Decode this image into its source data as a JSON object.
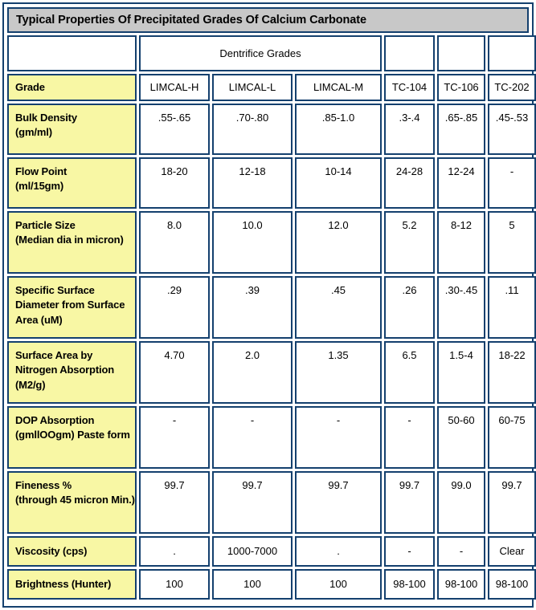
{
  "table": {
    "title": "Typical Properties Of Precipitated Grades Of Calcium Carbonate",
    "group_header": {
      "label_blank": "",
      "dentrifice_grades": "Dentrifice Grades",
      "tc104_blank": "",
      "tc106_blank": "",
      "tc202_blank": ""
    },
    "columns": {
      "property": "Grade",
      "grades": [
        "LIMCAL-H",
        "LIMCAL-L",
        "LIMCAL-M",
        "TC-104",
        "TC-106",
        "TC-202"
      ]
    },
    "rows": [
      {
        "property": "Bulk Density",
        "unit": "(gm/ml)",
        "values": [
          ".55-.65",
          ".70-.80",
          ".85-1.0",
          ".3-.4",
          ".65-.85",
          ".45-.53"
        ]
      },
      {
        "property": "Flow Point",
        "unit": "(ml/15gm)",
        "values": [
          "18-20",
          "12-18",
          "10-14",
          "24-28",
          "12-24",
          "-"
        ]
      },
      {
        "property": "Particle Size",
        "unit": "(Median dia in micron)",
        "values": [
          "8.0",
          "10.0",
          "12.0",
          "5.2",
          "8-12",
          "5"
        ]
      },
      {
        "property": "Specific Surface Diameter from Surface Area",
        "unit": "(uM)",
        "values": [
          ".29",
          ".39",
          ".45",
          ".26",
          ".30-.45",
          ".11"
        ]
      },
      {
        "property": "Surface Area by Nitrogen Absorption",
        "unit": "(M2/g)",
        "values": [
          "4.70",
          "2.0",
          "1.35",
          "6.5",
          "1.5-4",
          "18-22"
        ]
      },
      {
        "property": "DOP Absorption",
        "unit": "(gmllOOgm) Paste form",
        "values": [
          "-",
          "-",
          "-",
          "-",
          "50-60",
          "60-75"
        ]
      },
      {
        "property": "Fineness %",
        "unit": "(through 45 micron Min.)",
        "values": [
          "99.7",
          "99.7",
          "99.7",
          "99.7",
          "99.0",
          "99.7"
        ]
      },
      {
        "property": "Viscosity",
        "unit": "(cps)",
        "values": [
          ".",
          "1000-7000",
          ".",
          "-",
          "-",
          "Clear"
        ]
      },
      {
        "property": "Brightness",
        "unit": "(Hunter)",
        "values": [
          "100",
          "100",
          "100",
          "98-100",
          "98-100",
          "98-100"
        ]
      }
    ]
  },
  "colors": {
    "title_bar_bg": "#c8c8c8",
    "label_cell_bg": "#f8f7a4",
    "border": "#14406e",
    "text": "#000000"
  }
}
